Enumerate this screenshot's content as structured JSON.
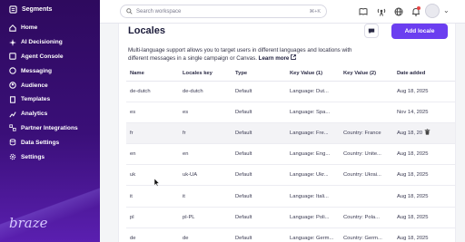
{
  "sidebar": {
    "app_title": "Segments",
    "items": [
      {
        "label": "Home",
        "icon": "home-icon"
      },
      {
        "label": "AI Decisioning",
        "icon": "ai-icon"
      },
      {
        "label": "Agent Console",
        "icon": "agent-icon"
      },
      {
        "label": "Messaging",
        "icon": "messaging-icon"
      },
      {
        "label": "Audience",
        "icon": "audience-icon"
      },
      {
        "label": "Templates",
        "icon": "templates-icon"
      },
      {
        "label": "Analytics",
        "icon": "analytics-icon"
      },
      {
        "label": "Partner Integrations",
        "icon": "integrations-icon"
      },
      {
        "label": "Data Settings",
        "icon": "data-settings-icon"
      },
      {
        "label": "Settings",
        "icon": "gear-icon"
      }
    ],
    "brand": "braze"
  },
  "topbar": {
    "search_placeholder": "Search workspace",
    "search_shortcut": "⌘+K"
  },
  "page": {
    "title": "Locales",
    "add_button": "Add locale",
    "description": "Multi-language support allows you to target users in different languages and locations with different messages in a single campaign or Canvas.",
    "learn_more": "Learn more"
  },
  "table": {
    "headers": [
      "Name",
      "Locales key",
      "Type",
      "Key Value (1)",
      "Key Value (2)",
      "Date added"
    ],
    "rows": [
      [
        "de-dutch",
        "de-dutch",
        "Default",
        "Language: Dut...",
        "",
        "Aug 18, 2025"
      ],
      [
        "es",
        "es",
        "Default",
        "Language: Spa...",
        "",
        "Nov 14, 2025"
      ],
      [
        "fr",
        "fr",
        "Default",
        "Language: Fre...",
        "Country: France",
        "Aug 18, 20"
      ],
      [
        "en",
        "en",
        "Default",
        "Language: Eng...",
        "Country: Unite...",
        "Aug 18, 2025"
      ],
      [
        "uk",
        "uk-UA",
        "Default",
        "Language: Ukr...",
        "Country: Ukrai...",
        "Aug 18, 2025"
      ],
      [
        "it",
        "it",
        "Default",
        "Language: Itali...",
        "",
        "Aug 18, 2025"
      ],
      [
        "pl",
        "pl-PL",
        "Default",
        "Language: Poli...",
        "Country: Pola...",
        "Aug 18, 2025"
      ],
      [
        "de",
        "de",
        "Default",
        "Language: Germ...",
        "Country: Germ...",
        "Aug 18, 2025"
      ]
    ]
  },
  "colors": {
    "sidebar": "#3a0f78",
    "accent": "#6b3ef0",
    "notification": "#e64545"
  }
}
